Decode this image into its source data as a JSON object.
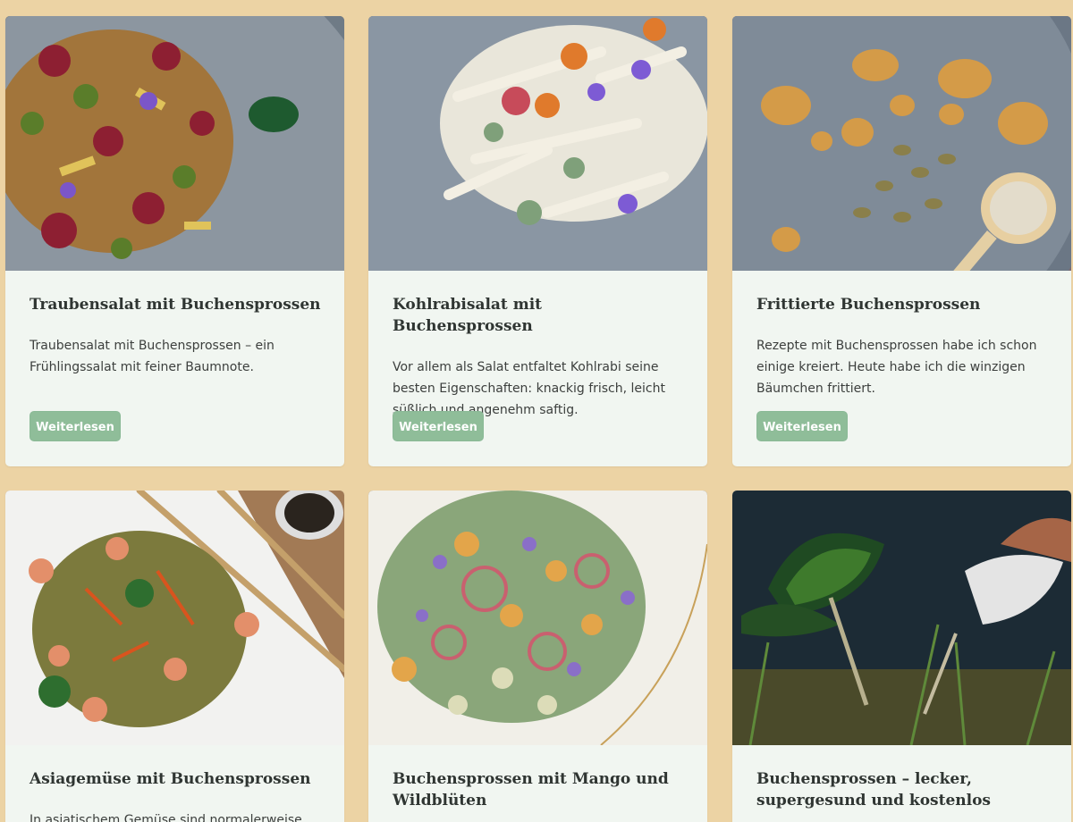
{
  "colors": {
    "page_background": "#ecd3a4",
    "card_background": "#f1f6f1",
    "button": "#8fbd99",
    "title": "#2f3532"
  },
  "cards": [
    {
      "title": "Traubensalat mit Buchensprossen",
      "excerpt": "Traubensalat mit Buchensprossen – ein Frühlingssalat mit feiner Baumnote.",
      "button": "Weiterlesen"
    },
    {
      "title": "Kohlrabisalat mit Buchensprossen",
      "excerpt": "Vor allem als Salat entfaltet Kohlrabi seine besten Eigenschaften: knackig frisch, leicht süßlich und angenehm saftig.",
      "button": "Weiterlesen"
    },
    {
      "title": "Frittierte Buchensprossen",
      "excerpt": "Rezepte mit Buchensprossen habe ich schon einige kreiert. Heute habe ich die winzigen Bäumchen frittiert.",
      "button": "Weiterlesen"
    },
    {
      "title": "Asiagemüse mit Buchensprossen",
      "excerpt": "In asiatischem Gemüse sind normalerweise"
    },
    {
      "title": "Buchensprossen mit Mango und Wildblüten"
    },
    {
      "title": "Buchensprossen – lecker, supergesund und kostenlos"
    }
  ]
}
